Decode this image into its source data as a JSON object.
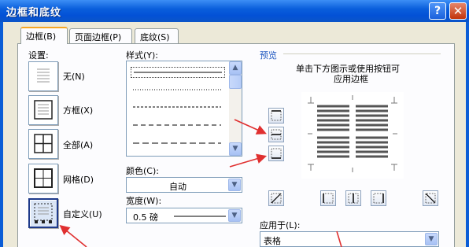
{
  "window": {
    "title": "边框和底纹",
    "help_glyph": "?",
    "close_glyph": "✕"
  },
  "tabs": [
    {
      "label": "边框(B)",
      "active": true
    },
    {
      "label": "页面边框(P)",
      "active": false
    },
    {
      "label": "底纹(S)",
      "active": false
    }
  ],
  "settings": {
    "label": "设置:",
    "items": [
      {
        "label": "无(N)",
        "icon": "setting-none-icon",
        "selected": false
      },
      {
        "label": "方框(X)",
        "icon": "setting-box-icon",
        "selected": false
      },
      {
        "label": "全部(A)",
        "icon": "setting-all-icon",
        "selected": false
      },
      {
        "label": "网格(D)",
        "icon": "setting-grid-icon",
        "selected": false
      },
      {
        "label": "自定义(U)",
        "icon": "setting-custom-icon",
        "selected": true
      }
    ]
  },
  "style": {
    "label": "样式(Y):",
    "lines": [
      "solid",
      "dotted",
      "dash-small",
      "dash-medium",
      "dash-large"
    ],
    "selected_index": 0
  },
  "color": {
    "label": "颜色(C):",
    "value": "自动"
  },
  "width": {
    "label": "宽度(W):",
    "value": "0.5 磅"
  },
  "preview": {
    "label": "预览",
    "hint_line1": "单击下方图示或使用按钮可",
    "hint_line2": "应用边框"
  },
  "apply_to": {
    "label": "应用于(L):",
    "value": "表格"
  },
  "colors": {
    "title_bar": "#0a5fdc",
    "dialog_bg": "#ece9d8",
    "panel_bg": "#fcfcfe",
    "group_label": "#2159c0",
    "annotation_arrow": "#e03030",
    "tab_highlight": "#f6a623"
  }
}
